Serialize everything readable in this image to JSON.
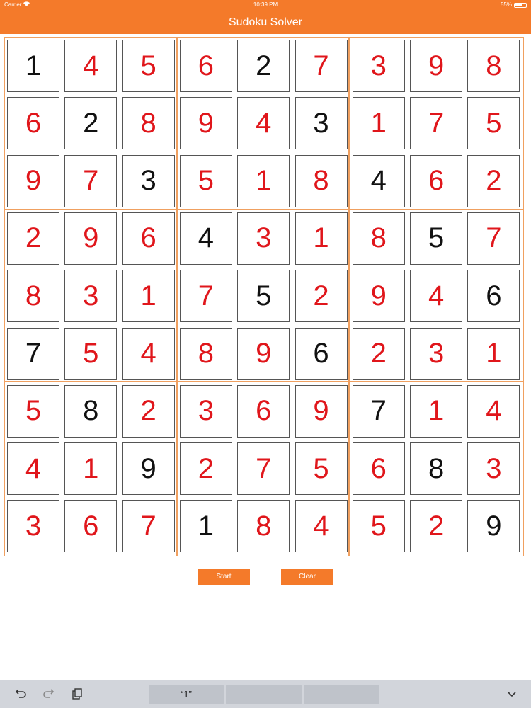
{
  "status": {
    "carrier": "Carrier",
    "wifi": "wifi-icon",
    "time": "10:39 PM",
    "battery_percent": "55%",
    "battery_level": 0.55
  },
  "nav": {
    "title": "Sudoku Solver"
  },
  "colors": {
    "accent": "#F47A2A",
    "given": "#111111",
    "solved": "#E0161B",
    "box_border": "#F0A060"
  },
  "board": {
    "values": [
      [
        "1",
        "4",
        "5",
        "6",
        "2",
        "7",
        "3",
        "9",
        "8"
      ],
      [
        "6",
        "2",
        "8",
        "9",
        "4",
        "3",
        "1",
        "7",
        "5"
      ],
      [
        "9",
        "7",
        "3",
        "5",
        "1",
        "8",
        "4",
        "6",
        "2"
      ],
      [
        "2",
        "9",
        "6",
        "4",
        "3",
        "1",
        "8",
        "5",
        "7"
      ],
      [
        "8",
        "3",
        "1",
        "7",
        "5",
        "2",
        "9",
        "4",
        "6"
      ],
      [
        "7",
        "5",
        "4",
        "8",
        "9",
        "6",
        "2",
        "3",
        "1"
      ],
      [
        "5",
        "8",
        "2",
        "3",
        "6",
        "9",
        "7",
        "1",
        "4"
      ],
      [
        "4",
        "1",
        "9",
        "2",
        "7",
        "5",
        "6",
        "8",
        "3"
      ],
      [
        "3",
        "6",
        "7",
        "1",
        "8",
        "4",
        "5",
        "2",
        "9"
      ]
    ],
    "given": [
      [
        1,
        0,
        0,
        0,
        1,
        0,
        0,
        0,
        0
      ],
      [
        0,
        1,
        0,
        0,
        0,
        1,
        0,
        0,
        0
      ],
      [
        0,
        0,
        1,
        0,
        0,
        0,
        1,
        0,
        0
      ],
      [
        0,
        0,
        0,
        1,
        0,
        0,
        0,
        1,
        0
      ],
      [
        0,
        0,
        0,
        0,
        1,
        0,
        0,
        0,
        1
      ],
      [
        1,
        0,
        0,
        0,
        0,
        1,
        0,
        0,
        0
      ],
      [
        0,
        1,
        0,
        0,
        0,
        0,
        1,
        0,
        0
      ],
      [
        0,
        0,
        1,
        0,
        0,
        0,
        0,
        1,
        0
      ],
      [
        0,
        0,
        0,
        1,
        0,
        0,
        0,
        0,
        1
      ]
    ]
  },
  "buttons": {
    "start": "Start",
    "clear": "Clear"
  },
  "keyboard": {
    "undo_icon": "undo-icon",
    "redo_icon": "redo-icon",
    "paste_icon": "paste-icon",
    "suggestions": [
      "“1”",
      "",
      ""
    ],
    "dismiss_icon": "chevron-down-icon"
  }
}
